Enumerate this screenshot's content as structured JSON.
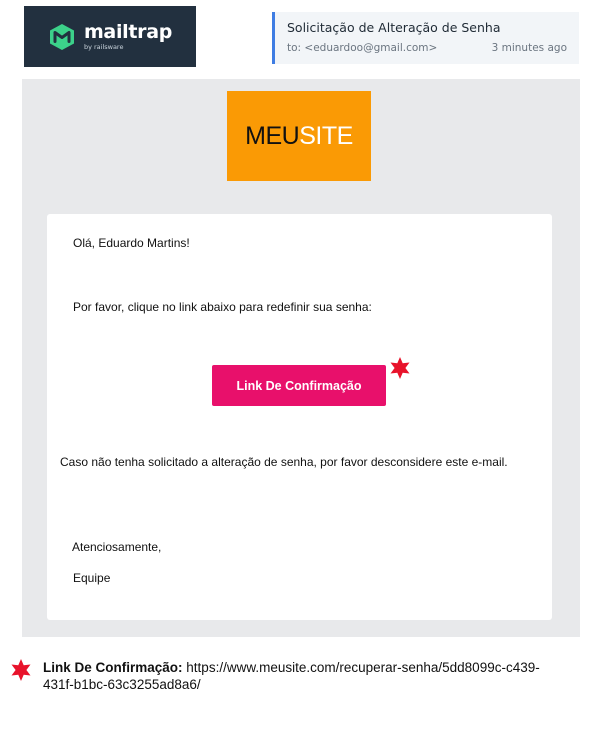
{
  "brand": {
    "name": "mailtrap",
    "sub": "by railsware",
    "colors": {
      "background": "#22303f",
      "mark": "#3cd18a"
    }
  },
  "email": {
    "subject": "Solicitação de Alteração de Senha",
    "to": "to: <eduardoo@gmail.com>",
    "time": "3 minutes ago"
  },
  "site_logo": {
    "part_a": "MEU",
    "part_b": "SITE",
    "background": "#fa9a05"
  },
  "message": {
    "greeting": "Olá, Eduardo Martins!",
    "instruction": "Por favor, clique no link abaixo para redefinir sua senha:",
    "button_label": "Link De Confirmação",
    "button_color": "#e8106b",
    "disclaimer": "Caso não tenha solicitado a alteração de senha, por favor desconsidere este e-mail.",
    "closing": "Atenciosamente,",
    "signature": "Equipe"
  },
  "note": {
    "label": "Link De Confirmação:",
    "url": "https://www.meusite.com/recuperar-senha/5dd8099c-c439-431f-b1bc-63c3255ad8a6/",
    "star_color": "#e8132b"
  }
}
